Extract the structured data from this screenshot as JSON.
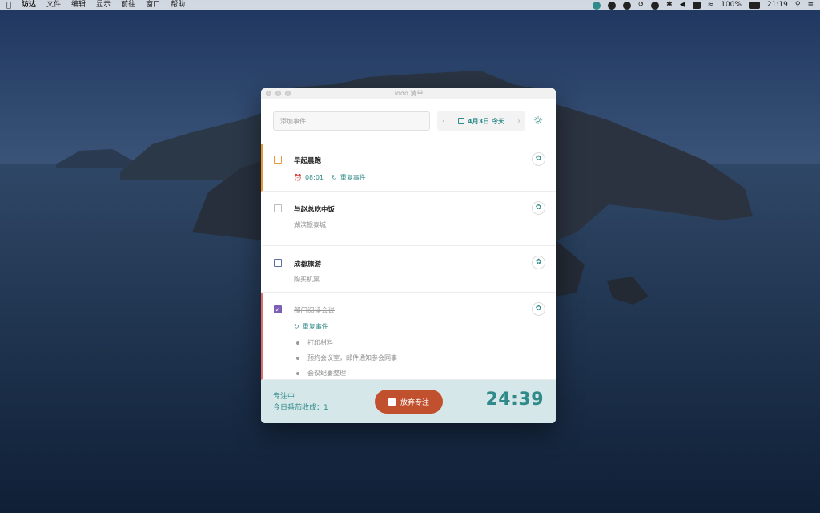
{
  "menubar": {
    "apple": "",
    "items": [
      "访达",
      "文件",
      "编辑",
      "显示",
      "前往",
      "窗口",
      "帮助"
    ],
    "battery": "100%",
    "clock": "21:19"
  },
  "window": {
    "title": "Todo 清单"
  },
  "toolbar": {
    "add_placeholder": "添加事件",
    "date_label": "4月3日 今天",
    "prev_glyph": "‹",
    "next_glyph": "›",
    "theme_glyph": "☼"
  },
  "tasks": [
    {
      "title": "早起晨跑",
      "time": "08:01",
      "repeat": "重复事件"
    },
    {
      "title": "与赵总吃中饭",
      "note": "湖滨银泰城"
    },
    {
      "title": "成都旅游",
      "note": "购买机票"
    },
    {
      "title": "部门阅读会议",
      "repeat": "重复事件",
      "subtasks": [
        "打印材料",
        "预约会议室，邮件通知参会同事",
        "会议纪要整理"
      ]
    }
  ],
  "focus": {
    "status": "专注中",
    "tomato_count": "今日番茄收成：1",
    "abandon_label": "放弃专注",
    "timer": "24:39"
  },
  "colors": {
    "accent": "#2f8a89",
    "orange": "#e8963a",
    "red": "#e26d6d",
    "purple": "#7e5fb8",
    "abandon": "#c0502e",
    "focus_bg": "#d6e7e9"
  }
}
